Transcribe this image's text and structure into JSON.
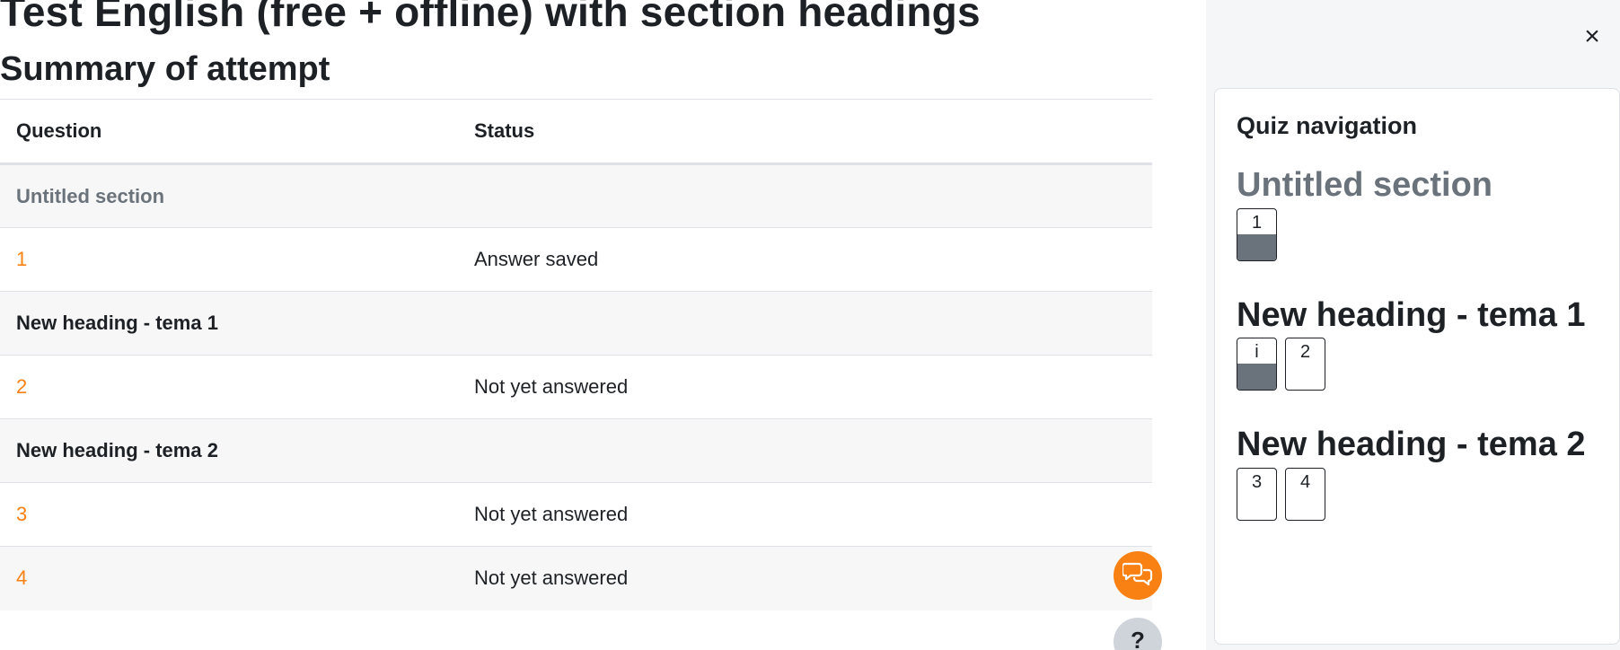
{
  "quiz_title": "Test English (free + offline) with section headings",
  "summary_title": "Summary of attempt",
  "table": {
    "headers": {
      "question": "Question",
      "status": "Status"
    },
    "sections": [
      {
        "heading": "Untitled section",
        "rows": [
          {
            "q": "1",
            "status": "Answer saved"
          }
        ]
      },
      {
        "heading": "New heading - tema 1",
        "rows": [
          {
            "q": "2",
            "status": "Not yet answered"
          }
        ]
      },
      {
        "heading": "New heading - tema 2",
        "rows": [
          {
            "q": "3",
            "status": "Not yet answered"
          },
          {
            "q": "4",
            "status": "Not yet answered"
          }
        ]
      }
    ]
  },
  "drawer": {
    "close_glyph": "×",
    "title": "Quiz navigation",
    "sections": [
      {
        "title": "Untitled section",
        "buttons": [
          {
            "label": "1",
            "answered": true
          }
        ]
      },
      {
        "title": "New heading - tema 1",
        "buttons": [
          {
            "label": "i",
            "answered": true
          },
          {
            "label": "2",
            "answered": false
          }
        ]
      },
      {
        "title": "New heading - tema 2",
        "buttons": [
          {
            "label": "3",
            "answered": false
          },
          {
            "label": "4",
            "answered": false
          }
        ]
      }
    ]
  },
  "floating": {
    "chat_icon": "chat-bubbles-icon",
    "help_glyph": "?"
  },
  "colors": {
    "accent": "#f98012",
    "muted": "#6a737b",
    "answered_fill": "#6a737b"
  }
}
